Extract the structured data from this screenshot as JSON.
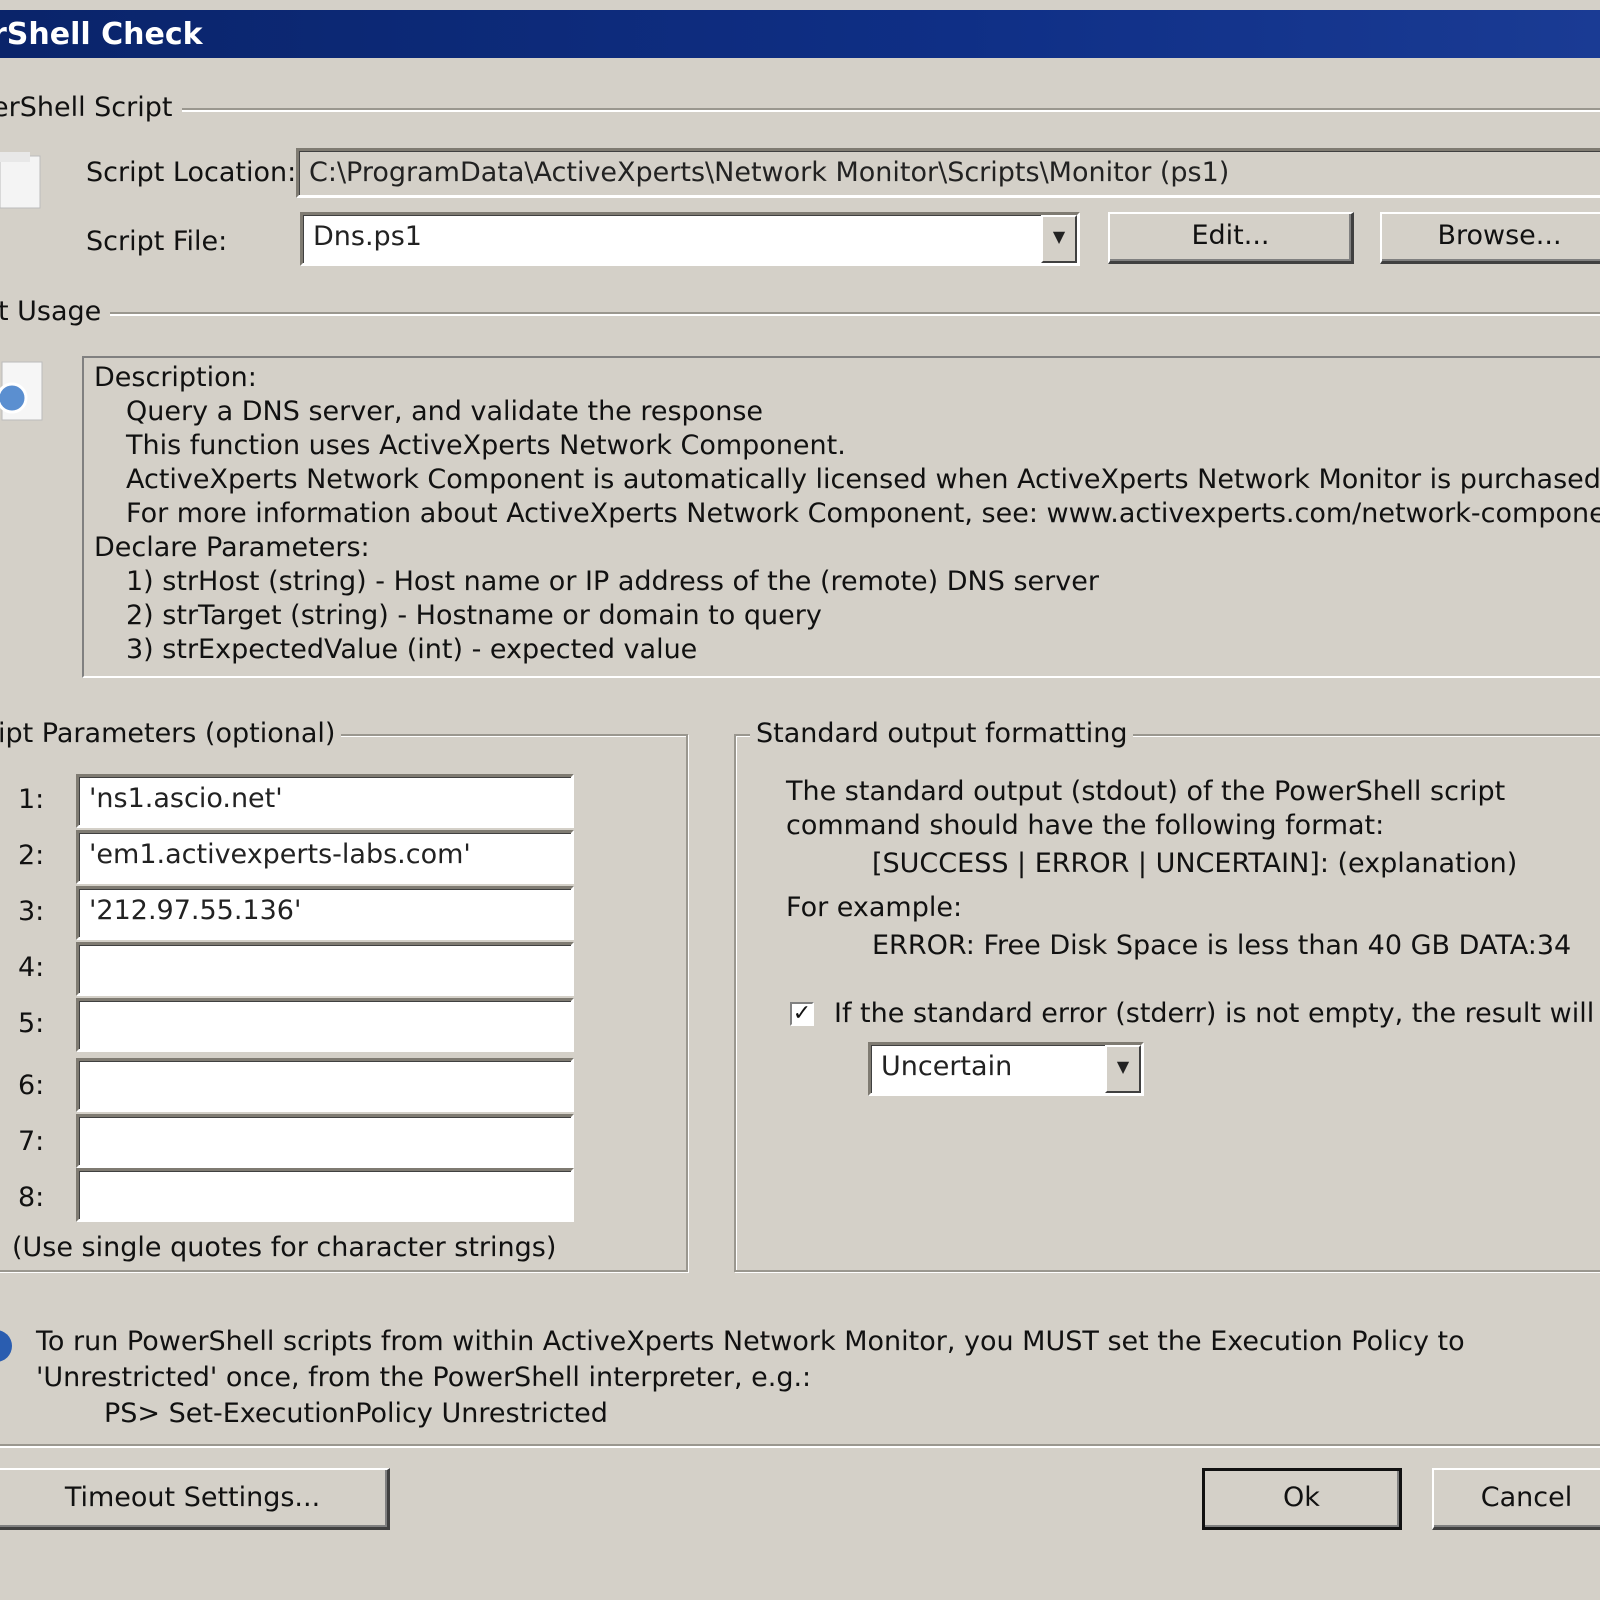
{
  "window": {
    "title": "rShell Check"
  },
  "script_group": {
    "legend": "erShell Script",
    "location_label": "Script Location:",
    "location_value": "C:\\ProgramData\\ActiveXperts\\Network Monitor\\Scripts\\Monitor (ps1)",
    "file_label": "Script File:",
    "file_value": "Dns.ps1",
    "edit_button": "Edit...",
    "browse_button": "Browse..."
  },
  "usage_group": {
    "legend": "t Usage",
    "description_lines": [
      "Description:",
      "Query a DNS server, and validate the response",
      "This function uses ActiveXperts Network Component.",
      "ActiveXperts Network Component is automatically licensed when ActiveXperts Network Monitor is purchased.",
      "For more information about ActiveXperts Network Component, see: www.activexperts.com/network-component",
      "Declare Parameters:",
      "1) strHost (string) - Host name or IP address of the (remote) DNS server",
      "2) strTarget (string) - Hostname or domain to query",
      "3) strExpectedValue (int) - expected value"
    ]
  },
  "params_group": {
    "legend": "ipt Parameters (optional)",
    "numbers": [
      "1:",
      "2:",
      "3:",
      "4:",
      "5:",
      "6:",
      "7:",
      "8:"
    ],
    "values": [
      "'ns1.ascio.net'",
      "'em1.activexperts-labs.com'",
      "'212.97.55.136'",
      "",
      "",
      "",
      "",
      ""
    ],
    "hint": "(Use single quotes for character strings)"
  },
  "output_group": {
    "legend": "Standard output formatting",
    "line1": "The standard output (stdout) of the PowerShell script",
    "line2": "command should have the following format:",
    "format": "[SUCCESS | ERROR | UNCERTAIN]: (explanation)",
    "example_label": "For example:",
    "example_value": "ERROR: Free Disk Space is less than 40 GB DATA:34",
    "stderr_checked": true,
    "stderr_label": "If the standard error (stderr) is not empty, the result will b",
    "result_value": "Uncertain"
  },
  "info": {
    "line1": "To run PowerShell scripts from within ActiveXperts Network Monitor, you MUST set the Execution Policy to",
    "line2": "'Unrestricted' once, from the PowerShell interpreter, e.g.:",
    "line3": "PS> Set-ExecutionPolicy Unrestricted"
  },
  "footer": {
    "timeout_button": "Timeout Settings...",
    "ok_button": "Ok",
    "cancel_button": "Cancel"
  },
  "colors": {
    "titlebar": "#0a246a",
    "face": "#d4d0c8"
  },
  "icons": [
    "script-icon",
    "info-usage-icon",
    "info-icon",
    "checkmark-icon",
    "dropdown-arrow-icon"
  ]
}
